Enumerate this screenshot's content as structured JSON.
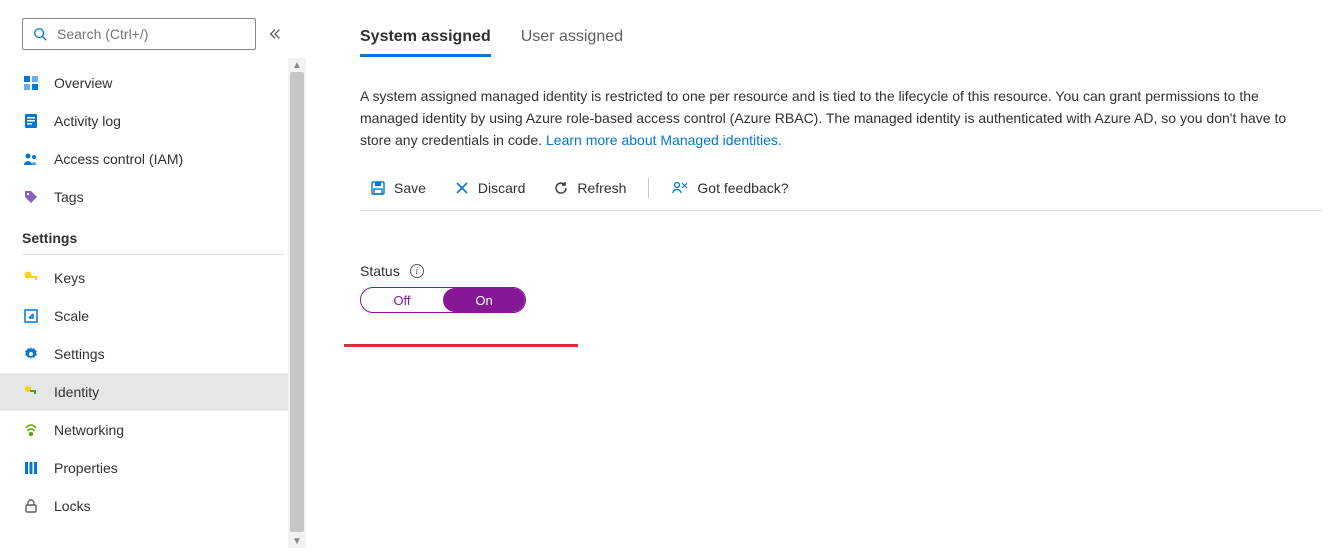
{
  "search": {
    "placeholder": "Search (Ctrl+/)"
  },
  "sidebar": {
    "items_top": [
      {
        "label": "Overview"
      },
      {
        "label": "Activity log"
      },
      {
        "label": "Access control (IAM)"
      },
      {
        "label": "Tags"
      }
    ],
    "group_header": "Settings",
    "items_settings": [
      {
        "label": "Keys"
      },
      {
        "label": "Scale"
      },
      {
        "label": "Settings"
      },
      {
        "label": "Identity"
      },
      {
        "label": "Networking"
      },
      {
        "label": "Properties"
      },
      {
        "label": "Locks"
      }
    ]
  },
  "tabs": {
    "system": "System assigned",
    "user": "User assigned"
  },
  "description": {
    "text": "A system assigned managed identity is restricted to one per resource and is tied to the lifecycle of this resource. You can grant permissions to the managed identity by using Azure role-based access control (Azure RBAC). The managed identity is authenticated with Azure AD, so you don't have to store any credentials in code. ",
    "link_text": "Learn more about Managed identities."
  },
  "toolbar": {
    "save": "Save",
    "discard": "Discard",
    "refresh": "Refresh",
    "feedback": "Got feedback?"
  },
  "status": {
    "label": "Status",
    "off": "Off",
    "on": "On",
    "value": "On"
  }
}
